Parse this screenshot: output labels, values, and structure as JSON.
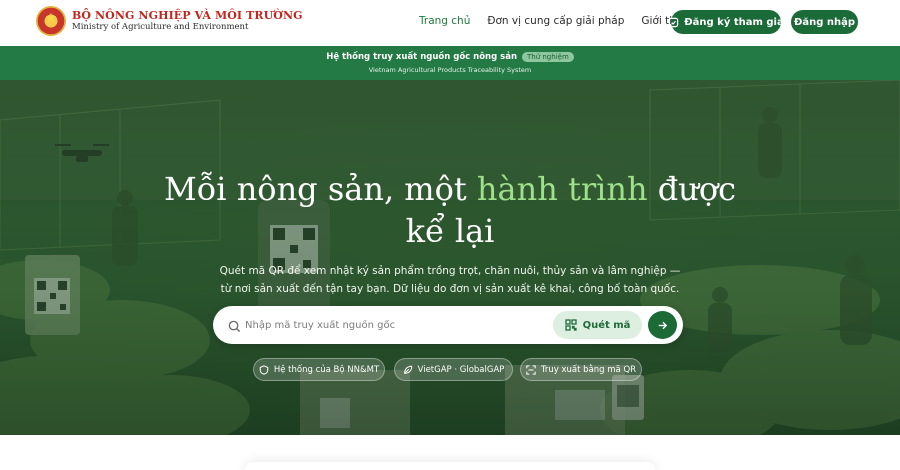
{
  "header": {
    "logo_vi": "BỘ NÔNG NGHIỆP VÀ MÔI TRƯỜNG",
    "logo_en": "Ministry of Agriculture and Environment",
    "nav": [
      {
        "label": "Trang chủ",
        "active": true
      },
      {
        "label": "Đơn vị cung cấp giải pháp",
        "active": false
      },
      {
        "label": "Giới thiệu",
        "active": false
      }
    ],
    "register_label": "Đăng ký tham gia",
    "login_label": "Đăng nhập"
  },
  "banner": {
    "title": "Hệ thống truy xuất nguồn gốc nông sản",
    "badge": "Thử nghiệm",
    "subtitle": "Vietnam Agricultural Products Traceability System"
  },
  "hero": {
    "title_part1": "Mỗi nông sản, một ",
    "title_highlight": "hành trình",
    "title_part2": " được",
    "title_line2": "kể lại",
    "subtitle_line1": "Quét mã QR để xem nhật ký sản phẩm trồng trọt, chăn nuôi, thủy sản và lâm nghiệp —",
    "subtitle_line2": "từ nơi sản xuất đến tận tay bạn. Dữ liệu do đơn vị sản xuất kê khai, công bố toàn quốc.",
    "search_placeholder": "Nhập mã truy xuất nguồn gốc",
    "scan_label": "Quét mã",
    "chips": [
      "Hệ thống của Bộ NN&MT",
      "VietGAP · GlobalGAP",
      "Truy xuất bằng mã QR"
    ]
  },
  "colors": {
    "primary": "#1a6b37",
    "banner": "#237a44",
    "highlight": "#9fe08a",
    "logo_red": "#c2261d"
  }
}
